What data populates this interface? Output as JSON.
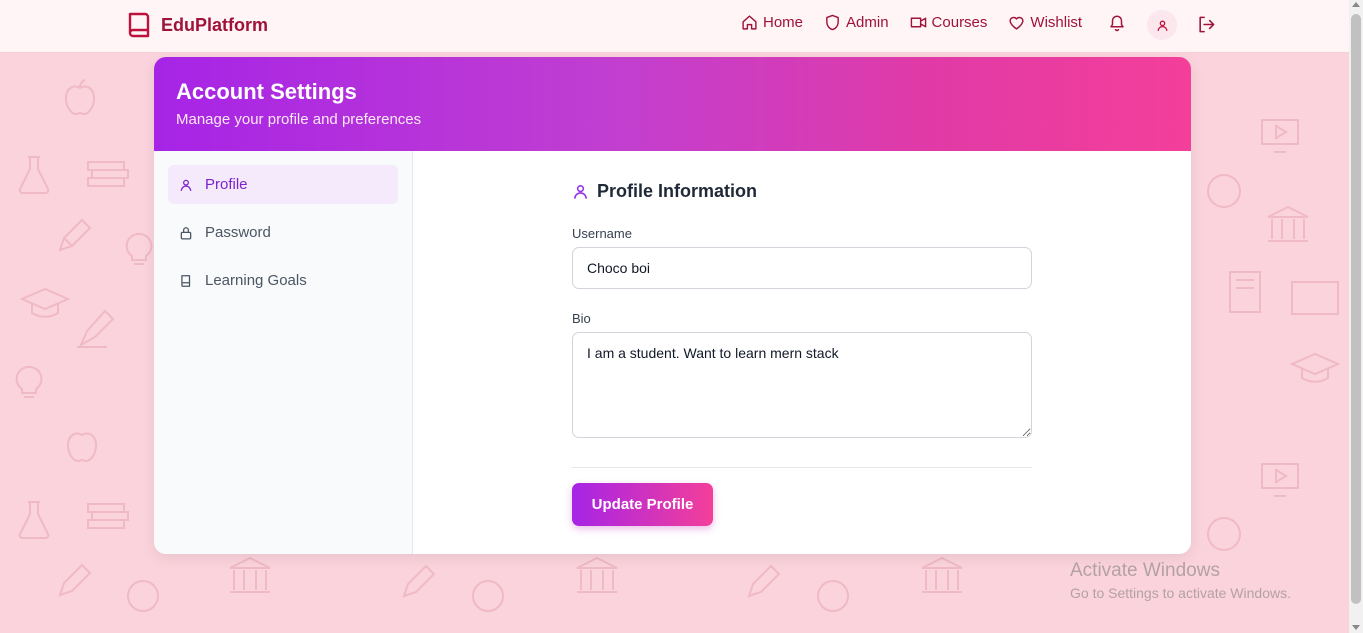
{
  "nav": {
    "brand": "EduPlatform",
    "links": [
      {
        "label": "Home",
        "icon": "home-icon"
      },
      {
        "label": "Admin",
        "icon": "shield-icon"
      },
      {
        "label": "Courses",
        "icon": "video-icon"
      },
      {
        "label": "Wishlist",
        "icon": "heart-icon"
      }
    ],
    "icons": [
      "bell-icon",
      "user-icon",
      "logout-icon"
    ]
  },
  "settings": {
    "title": "Account Settings",
    "subtitle": "Manage your profile and preferences",
    "sidebar": [
      {
        "label": "Profile",
        "icon": "user-icon",
        "active": true
      },
      {
        "label": "Password",
        "icon": "lock-icon",
        "active": false
      },
      {
        "label": "Learning Goals",
        "icon": "book-icon",
        "active": false
      }
    ]
  },
  "profile": {
    "section_title": "Profile Information",
    "username_label": "Username",
    "username_value": "Choco boi",
    "bio_label": "Bio",
    "bio_value": "I am a student. Want to learn mern stack",
    "submit_label": "Update Profile"
  },
  "watermark": {
    "title": "Activate Windows",
    "subtitle": "Go to Settings to activate Windows."
  },
  "colors": {
    "brand": "#9f1239",
    "accent_purple": "#a624e6",
    "accent_pink": "#f43f9a",
    "background": "#fbd3dc"
  }
}
